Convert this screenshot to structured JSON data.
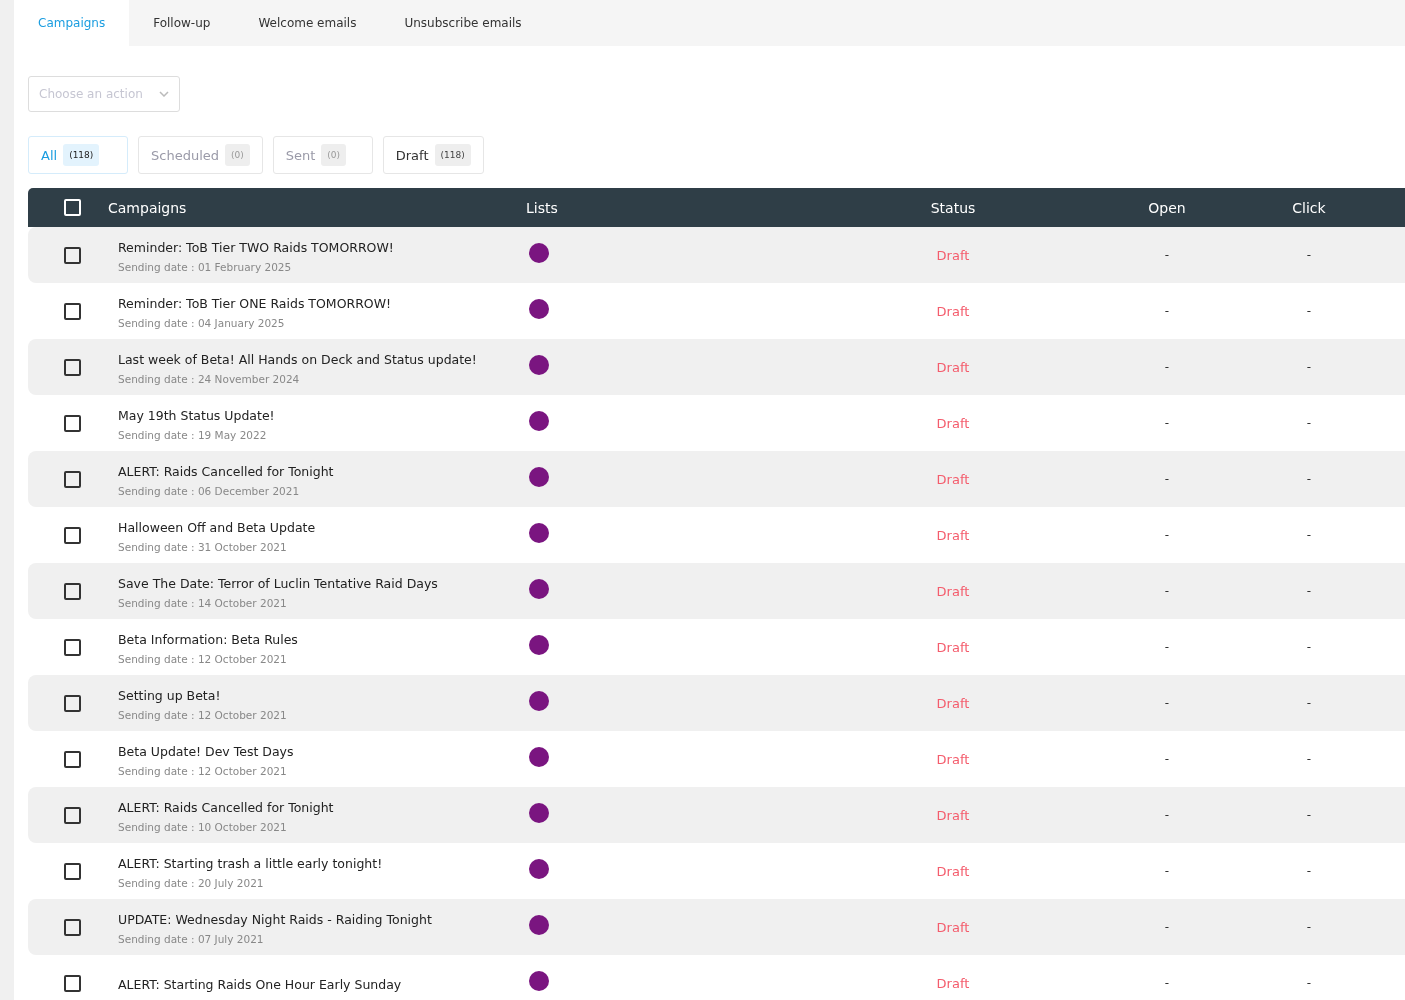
{
  "tabs": [
    {
      "label": "Campaigns",
      "selected": true
    },
    {
      "label": "Follow-up",
      "selected": false
    },
    {
      "label": "Welcome emails",
      "selected": false
    },
    {
      "label": "Unsubscribe emails",
      "selected": false
    }
  ],
  "action_select": {
    "placeholder": "Choose an action"
  },
  "filters": [
    {
      "label": "All",
      "count": "(118)",
      "selected": true,
      "disabled": false
    },
    {
      "label": "Scheduled",
      "count": "(0)",
      "selected": false,
      "disabled": true
    },
    {
      "label": "Sent",
      "count": "(0)",
      "selected": false,
      "disabled": true
    },
    {
      "label": "Draft",
      "count": "(118)",
      "selected": false,
      "disabled": false
    }
  ],
  "table": {
    "select_all_checked": false,
    "columns": [
      "Campaigns",
      "Lists",
      "Status",
      "Open",
      "Click"
    ],
    "rows": [
      {
        "title": "Reminder: ToB Tier TWO Raids TOMORROW!",
        "date": "Sending date : 01 February 2025",
        "color": "#7a1580",
        "status": "Draft",
        "open": "-",
        "click": "-",
        "checked": false
      },
      {
        "title": "Reminder: ToB Tier ONE Raids TOMORROW!",
        "date": "Sending date : 04 January 2025",
        "color": "#7a1580",
        "status": "Draft",
        "open": "-",
        "click": "-",
        "checked": false
      },
      {
        "title": "Last week of Beta! All Hands on Deck and Status update!",
        "date": "Sending date : 24 November 2024",
        "color": "#7a1580",
        "status": "Draft",
        "open": "-",
        "click": "-",
        "checked": false
      },
      {
        "title": "May 19th Status Update!",
        "date": "Sending date : 19 May 2022",
        "color": "#7a1580",
        "status": "Draft",
        "open": "-",
        "click": "-",
        "checked": false
      },
      {
        "title": "ALERT: Raids Cancelled for Tonight",
        "date": "Sending date : 06 December 2021",
        "color": "#7a1580",
        "status": "Draft",
        "open": "-",
        "click": "-",
        "checked": false
      },
      {
        "title": "Halloween Off and Beta Update",
        "date": "Sending date : 31 October 2021",
        "color": "#7a1580",
        "status": "Draft",
        "open": "-",
        "click": "-",
        "checked": false
      },
      {
        "title": "Save The Date: Terror of Luclin Tentative Raid Days",
        "date": "Sending date : 14 October 2021",
        "color": "#7a1580",
        "status": "Draft",
        "open": "-",
        "click": "-",
        "checked": false
      },
      {
        "title": "Beta Information: Beta Rules",
        "date": "Sending date : 12 October 2021",
        "color": "#7a1580",
        "status": "Draft",
        "open": "-",
        "click": "-",
        "checked": false
      },
      {
        "title": "Setting up Beta!",
        "date": "Sending date : 12 October 2021",
        "color": "#7a1580",
        "status": "Draft",
        "open": "-",
        "click": "-",
        "checked": false
      },
      {
        "title": "Beta Update! Dev Test Days",
        "date": "Sending date : 12 October 2021",
        "color": "#7a1580",
        "status": "Draft",
        "open": "-",
        "click": "-",
        "checked": false
      },
      {
        "title": "ALERT: Raids Cancelled for Tonight",
        "date": "Sending date : 10 October 2021",
        "color": "#7a1580",
        "status": "Draft",
        "open": "-",
        "click": "-",
        "checked": false
      },
      {
        "title": "ALERT: Starting trash a little early tonight!",
        "date": "Sending date : 20 July 2021",
        "color": "#7a1580",
        "status": "Draft",
        "open": "-",
        "click": "-",
        "checked": false
      },
      {
        "title": "UPDATE: Wednesday Night Raids - Raiding Tonight",
        "date": "Sending date : 07 July 2021",
        "color": "#7a1580",
        "status": "Draft",
        "open": "-",
        "click": "-",
        "checked": false
      },
      {
        "title": "ALERT: Starting Raids One Hour Early Sunday",
        "color": "#7a1580",
        "status": "Draft",
        "open": "-",
        "click": "-",
        "checked": false
      }
    ]
  }
}
